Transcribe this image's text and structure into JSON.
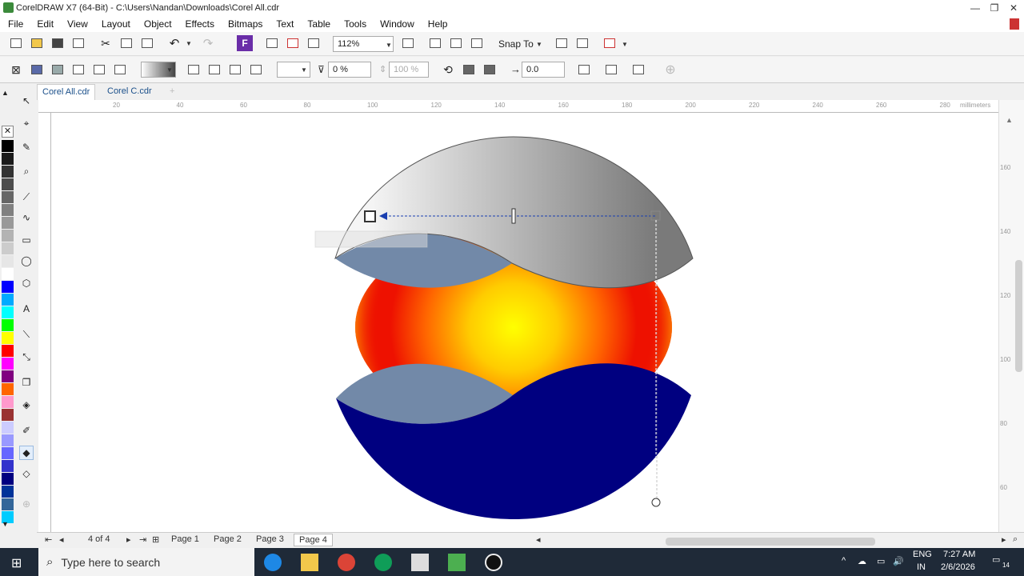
{
  "window": {
    "title": "CorelDRAW X7 (64-Bit) - C:\\Users\\Nandan\\Downloads\\Corel All.cdr",
    "minimize": "—",
    "maximize": "❐",
    "close": "✕"
  },
  "menu": [
    "File",
    "Edit",
    "View",
    "Layout",
    "Object",
    "Effects",
    "Bitmaps",
    "Text",
    "Table",
    "Tools",
    "Window",
    "Help"
  ],
  "toolbar": {
    "zoom": "112%",
    "snap_to": "Snap To"
  },
  "propbar": {
    "transparency_percent": "0 %",
    "merge_percent": "100 %",
    "angle_value": "0.0"
  },
  "doc_tabs": [
    "Corel All.cdr",
    "Corel C.cdr"
  ],
  "ruler": {
    "h_ticks": [
      "20",
      "40",
      "60",
      "80",
      "100",
      "120",
      "140",
      "160",
      "180",
      "200",
      "220",
      "240",
      "260",
      "280"
    ],
    "unit": "millimeters",
    "v_ticks": [
      "160",
      "140",
      "120",
      "100",
      "80",
      "60"
    ]
  },
  "status": {
    "page_counter": "4 of 4",
    "pages": [
      "Page 1",
      "Page 2",
      "Page 3",
      "Page 4"
    ],
    "active_page": "Page 4"
  },
  "palette": [
    "#000000",
    "#1a1a1a",
    "#333333",
    "#4d4d4d",
    "#666666",
    "#808080",
    "#999999",
    "#b3b3b3",
    "#cccccc",
    "#e6e6e6",
    "#ffffff",
    "#0000ff",
    "#00aaff",
    "#00ffff",
    "#00ff00",
    "#ffff00",
    "#ff0000",
    "#ff00ff",
    "#800080",
    "#ff6600",
    "#ff99cc",
    "#993333",
    "#ccccff",
    "#9999ff",
    "#6666ff",
    "#3333cc",
    "#000080",
    "#003399",
    "#336699",
    "#00ccff"
  ],
  "colors": {
    "dark_navy": "#000080",
    "slate": "#7289a8",
    "red": "#ee1100",
    "yellow": "#ffff00",
    "grey_light": "#f5f5f5",
    "grey_dark": "#7a7a7a"
  },
  "taskbar": {
    "search_placeholder": "Type here to search",
    "lang": "ENG",
    "region": "IN",
    "time": "7:27 AM",
    "date": "2/6/2026",
    "notif_count": "14"
  }
}
